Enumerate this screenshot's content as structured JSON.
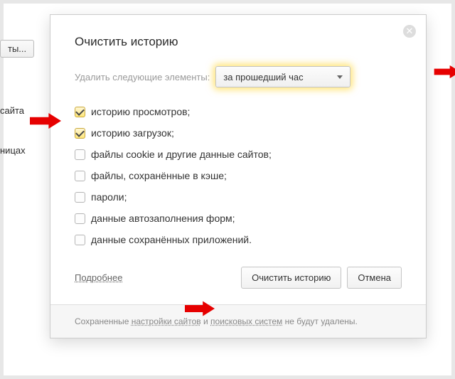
{
  "background": {
    "button_label": "ты...",
    "text1": "сайта",
    "text2": "ницах"
  },
  "dialog": {
    "title": "Очистить историю",
    "range_label": "Удалить следующие элементы:",
    "range_value": "за прошедший час",
    "checks": [
      {
        "label": "историю просмотров;",
        "checked": true
      },
      {
        "label": "историю загрузок;",
        "checked": true
      },
      {
        "label": "файлы cookie и другие данные сайтов;",
        "checked": false
      },
      {
        "label": "файлы, сохранённые в кэше;",
        "checked": false
      },
      {
        "label": "пароли;",
        "checked": false
      },
      {
        "label": "данные автозаполнения форм;",
        "checked": false
      },
      {
        "label": "данные сохранённых приложений.",
        "checked": false
      }
    ],
    "more_label": "Подробнее",
    "primary_label": "Очистить историю",
    "cancel_label": "Отмена",
    "footer_pre": "Сохраненные ",
    "footer_link1": "настройки сайтов",
    "footer_mid": " и ",
    "footer_link2": "поисковых систем",
    "footer_post": " не будут удалены."
  }
}
